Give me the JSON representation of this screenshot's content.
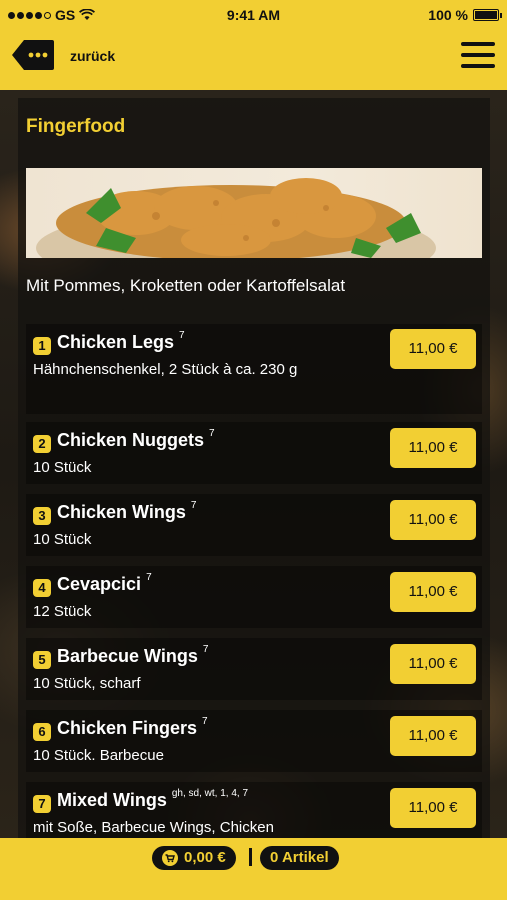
{
  "status_bar": {
    "carrier": "GS",
    "time": "9:41 AM",
    "battery": "100 %"
  },
  "header": {
    "back_label": "zurück"
  },
  "section": {
    "title": "Fingerfood",
    "subtitle": "Mit Pommes, Kroketten oder Kartoffelsalat"
  },
  "items": [
    {
      "number": "1",
      "name": "Chicken Legs",
      "allergens": "7",
      "description": "Hähnchenschenkel, 2 Stück à ca. 230 g",
      "price": "11,00 €"
    },
    {
      "number": "2",
      "name": "Chicken Nuggets",
      "allergens": "7",
      "description": "10 Stück",
      "price": "11,00 €"
    },
    {
      "number": "3",
      "name": "Chicken Wings",
      "allergens": "7",
      "description": "10 Stück",
      "price": "11,00 €"
    },
    {
      "number": "4",
      "name": "Cevapcici",
      "allergens": "7",
      "description": "12 Stück",
      "price": "11,00 €"
    },
    {
      "number": "5",
      "name": "Barbecue Wings",
      "allergens": "7",
      "description": "10 Stück, scharf",
      "price": "11,00 €"
    },
    {
      "number": "6",
      "name": "Chicken Fingers",
      "allergens": "7",
      "description": "10 Stück. Barbecue",
      "price": "11,00 €"
    },
    {
      "number": "7",
      "name": "Mixed Wings",
      "allergens": "gh, sd, wt, 1, 4, 7",
      "description": "mit Soße, Barbecue Wings, Chicken",
      "price": "11,00 €"
    }
  ],
  "cart": {
    "total": "0,00 €",
    "articles": "0 Artikel"
  },
  "colors": {
    "accent": "#f2cf33",
    "text_dark": "#111111",
    "text_light": "#ffffff"
  }
}
